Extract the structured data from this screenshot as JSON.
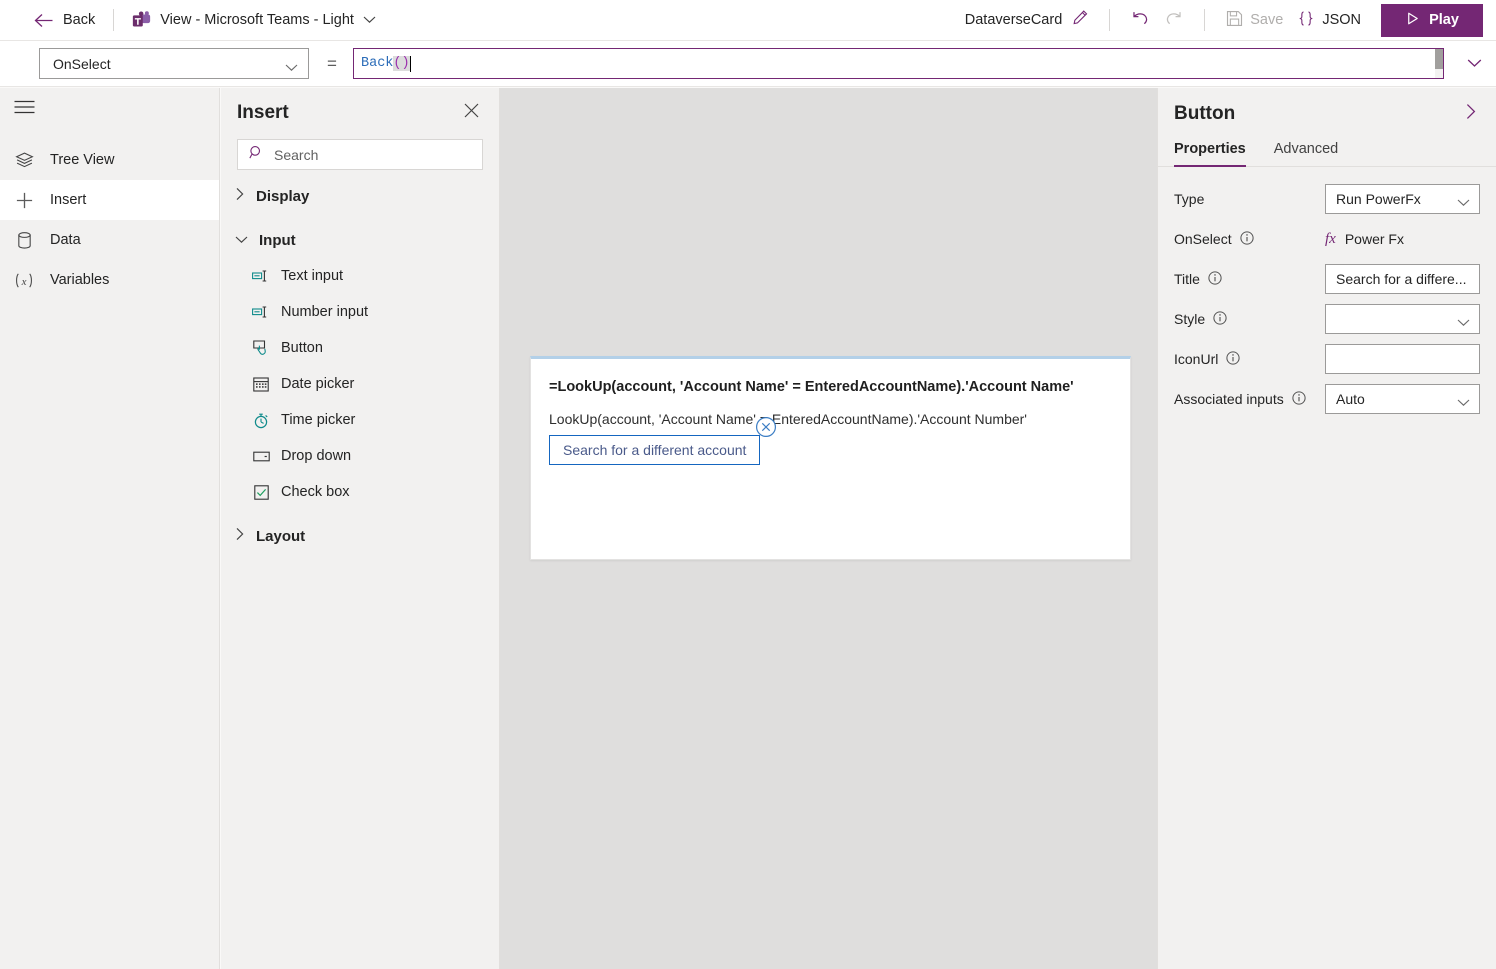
{
  "topbar": {
    "back_label": "Back",
    "back_icon": "arrow-left-icon",
    "doc_title": "View - Microsoft Teams - Light",
    "doc_icon": "microsoft-teams-icon",
    "doc_chevron_icon": "chevron-down-icon",
    "card_name": "DataverseCard",
    "edit_icon": "pencil-icon",
    "undo_icon": "undo-icon",
    "redo_icon": "redo-icon",
    "save_label": "Save",
    "save_icon": "save-disk-icon",
    "json_label": "JSON",
    "json_icon": "curly-braces-icon",
    "play_label": "Play",
    "play_icon": "play-triangle-icon",
    "accent_color": "#742774"
  },
  "formula_bar": {
    "property": "OnSelect",
    "property_chevron_icon": "chevron-down-icon",
    "equals": "=",
    "formula_function": "Back",
    "formula_parens": "()",
    "expand_icon": "chevron-down-icon",
    "border_color": "#742774"
  },
  "rail": {
    "menu_icon": "hamburger-menu-icon",
    "items": [
      {
        "label": "Tree View",
        "icon": "layers-icon",
        "active": false
      },
      {
        "label": "Insert",
        "icon": "plus-icon",
        "active": true
      },
      {
        "label": "Data",
        "icon": "database-icon",
        "active": false
      },
      {
        "label": "Variables",
        "icon": "variable-x-icon",
        "active": false
      }
    ]
  },
  "insert_panel": {
    "title": "Insert",
    "close_icon": "close-icon",
    "search_placeholder": "Search",
    "search_icon": "search-icon",
    "groups": [
      {
        "label": "Display",
        "expanded": false,
        "chevron_icon": "chevron-right-icon",
        "items": []
      },
      {
        "label": "Input",
        "expanded": true,
        "chevron_icon": "chevron-down-icon",
        "items": [
          {
            "label": "Text input",
            "icon": "text-input-icon"
          },
          {
            "label": "Number input",
            "icon": "number-input-icon"
          },
          {
            "label": "Button",
            "icon": "button-icon"
          },
          {
            "label": "Date picker",
            "icon": "calendar-icon"
          },
          {
            "label": "Time picker",
            "icon": "clock-icon"
          },
          {
            "label": "Drop down",
            "icon": "dropdown-icon"
          },
          {
            "label": "Check box",
            "icon": "checkbox-icon"
          }
        ]
      },
      {
        "label": "Layout",
        "expanded": false,
        "chevron_icon": "chevron-right-icon",
        "items": []
      }
    ]
  },
  "canvas": {
    "card": {
      "line1": "=LookUp(account, 'Account Name' = EnteredAccountName).'Account Name'",
      "line2": "LookUp(account, 'Account Name' = EnteredAccountName).'Account Number'",
      "button_label": "Search for a different account",
      "delete_handle_icon": "circle-x-icon",
      "accent_color": "#b3d0e8"
    }
  },
  "right_panel": {
    "title": "Button",
    "collapse_icon": "chevron-right-icon",
    "tabs": [
      {
        "label": "Properties",
        "active": true
      },
      {
        "label": "Advanced",
        "active": false
      }
    ],
    "properties": [
      {
        "label": "Type",
        "control": "select",
        "value": "Run PowerFx",
        "info": false,
        "info_icon": "",
        "chevron_icon": "chevron-down-icon"
      },
      {
        "label": "OnSelect",
        "control": "fx",
        "value": "Power Fx",
        "info": true,
        "info_icon": "info-icon",
        "fx_icon": "fx-icon"
      },
      {
        "label": "Title",
        "control": "text",
        "value": "Search for a differe...",
        "info": true,
        "info_icon": "info-icon"
      },
      {
        "label": "Style",
        "control": "select",
        "value": "",
        "info": true,
        "info_icon": "info-icon",
        "chevron_icon": "chevron-down-icon"
      },
      {
        "label": "IconUrl",
        "control": "text",
        "value": "",
        "info": true,
        "info_icon": "info-icon"
      },
      {
        "label": "Associated inputs",
        "control": "select",
        "value": "Auto",
        "info": true,
        "info_icon": "info-icon",
        "chevron_icon": "chevron-down-icon"
      }
    ]
  }
}
